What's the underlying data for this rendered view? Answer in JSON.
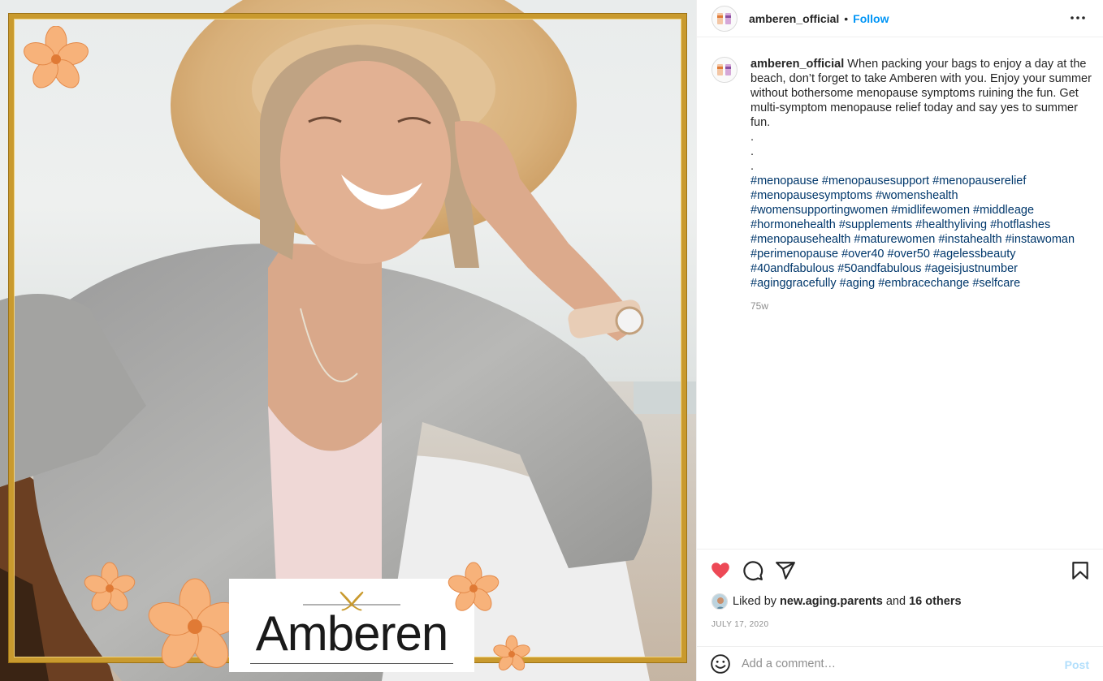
{
  "post": {
    "username": "amberen_official",
    "separator": "•",
    "follow_label": "Follow",
    "more_icon": "more-horizontal-icon",
    "brand_logo_text": "Amberen",
    "caption": {
      "username": "amberen_official",
      "text": "When packing your bags to enjoy a day at the beach, don’t forget to take Amberen with you. Enjoy your summer without bothersome menopause symptoms ruining the fun. Get multi-symptom menopause relief today and say yes to summer fun.",
      "dots": [
        ".",
        ".",
        "."
      ],
      "hashtags": [
        "#menopause",
        "#menopausesupport",
        "#menopauserelief",
        "#menopausesymptoms",
        "#womenshealth",
        "#womensupportingwomen",
        "#midlifewomen",
        "#middleage",
        "#hormonehealth",
        "#supplements",
        "#healthyliving",
        "#hotflashes",
        "#menopausehealth",
        "#maturewomen",
        "#instahealth",
        "#instawoman",
        "#perimenopause",
        "#over40",
        "#over50",
        "#agelessbeauty",
        "#40andfabulous",
        "#50andfabulous",
        "#ageisjustnumber",
        "#aginggracefully",
        "#aging",
        "#embracechange",
        "#selfcare"
      ],
      "age": "75w"
    },
    "actions": {
      "like_icon": "heart-filled-icon",
      "comment_icon": "comment-icon",
      "share_icon": "share-icon",
      "save_icon": "bookmark-icon",
      "like_color": "#ed4956"
    },
    "likes": {
      "prefix": "Liked by",
      "user": "new.aging.parents",
      "conjunction": "and",
      "others": "16 others"
    },
    "date": "JULY 17, 2020",
    "comment": {
      "placeholder": "Add a comment…",
      "post_label": "Post",
      "emoji_icon": "emoji-icon"
    }
  },
  "colors": {
    "link": "#0095f6",
    "hashtag": "#00376b",
    "frame_gold": "#c99a2e",
    "flower_orange": "#f7b27a"
  }
}
